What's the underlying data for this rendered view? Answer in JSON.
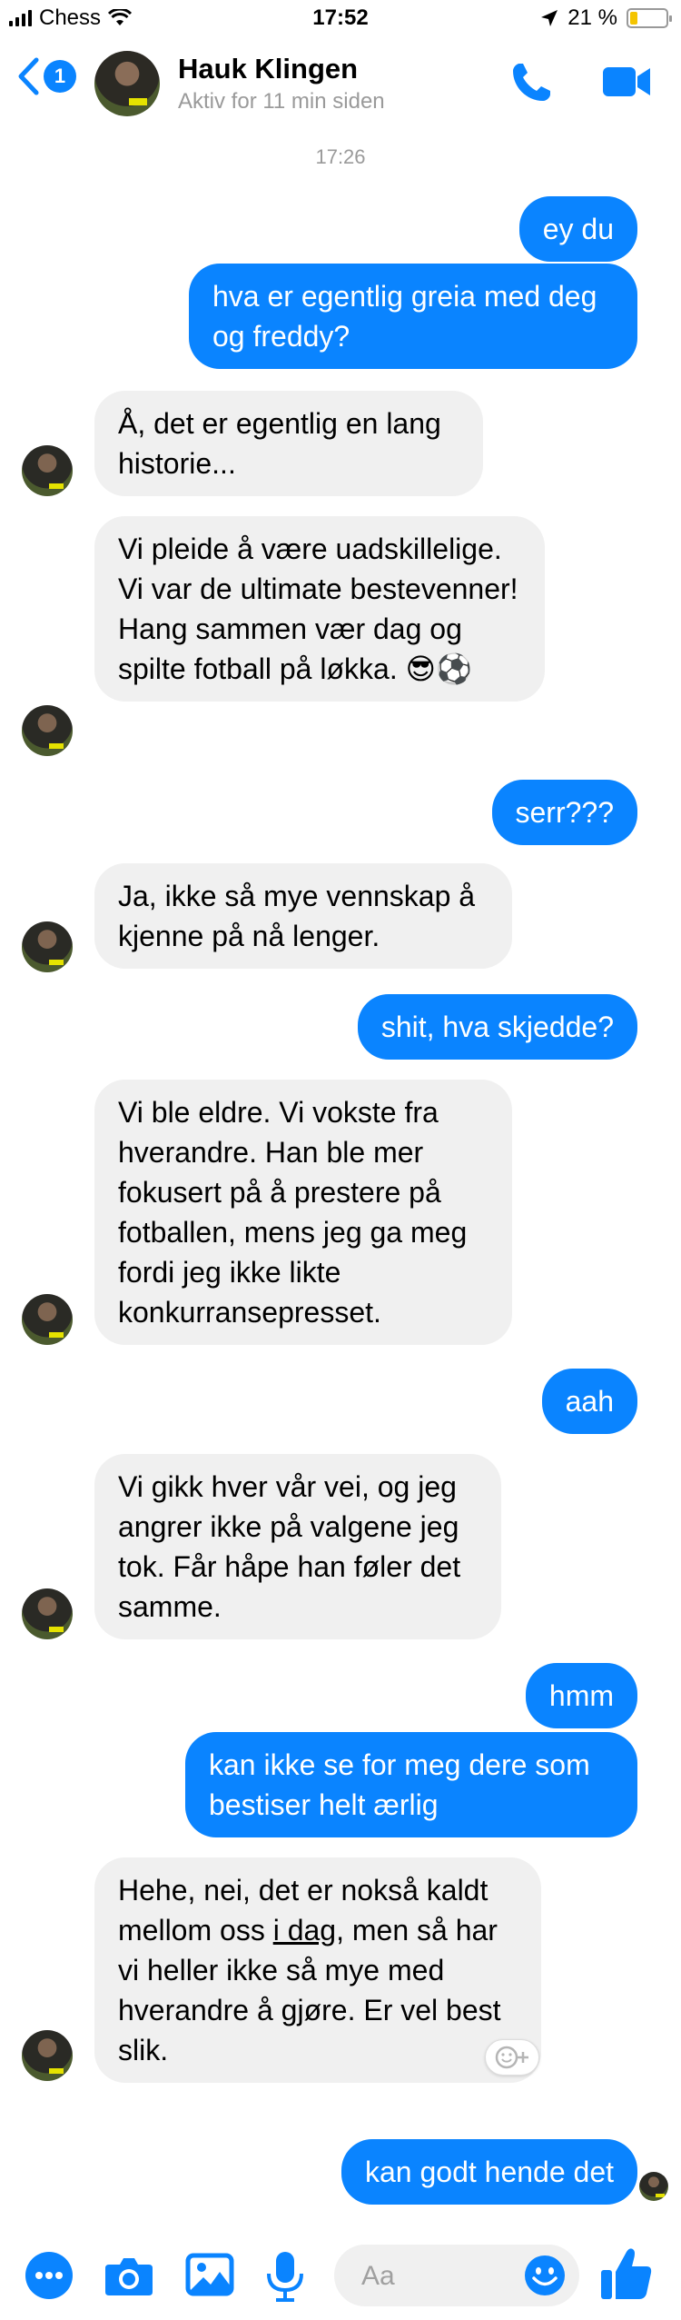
{
  "status_bar": {
    "carrier": "Chess",
    "time": "17:52",
    "battery": "21 %",
    "battery_level": 0.21
  },
  "header": {
    "back_count": "1",
    "name": "Hauk Klingen",
    "status": "Aktiv for 11 min siden"
  },
  "timestamp": "17:26",
  "messages": [
    {
      "dir": "out",
      "text": "ey du"
    },
    {
      "dir": "out",
      "text": "hva er egentlig greia med deg og freddy?"
    },
    {
      "dir": "in",
      "text": "Å, det er egentlig en lang historie..."
    },
    {
      "dir": "in",
      "text": "Vi pleide å være uadskillelige. Vi var de ultimate bestevenner! Hang sammen vær dag og spilte fotball på løkka. 😎⚽"
    },
    {
      "dir": "out",
      "text": "serr???"
    },
    {
      "dir": "in",
      "text": "Ja, ikke så mye vennskap å kjenne på nå lenger."
    },
    {
      "dir": "out",
      "text": "shit, hva skjedde?"
    },
    {
      "dir": "in",
      "text": "Vi ble eldre. Vi vokste fra hverandre. Han ble mer fokusert på å prestere på fotballen, mens jeg ga meg fordi jeg ikke likte konkurransepresset."
    },
    {
      "dir": "out",
      "text": "aah"
    },
    {
      "dir": "in",
      "text": "Vi gikk hver vår vei, og jeg angrer ikke på valgene jeg tok. Får håpe han føler det samme."
    },
    {
      "dir": "out",
      "text": "hmm"
    },
    {
      "dir": "out",
      "text": "kan ikke se for meg dere som bestiser helt ærlig"
    },
    {
      "dir": "in",
      "text_before": "Hehe, nei, det er nokså kaldt mellom oss ",
      "text_link": "i dag",
      "text_after": ", men så har vi heller ikke så mye med hverandre å gjøre. Er vel best slik."
    },
    {
      "dir": "out",
      "text": "kan godt hende det"
    }
  ],
  "composer": {
    "placeholder": "Aa"
  },
  "colors": {
    "accent": "#0a84ff",
    "incoming_bubble": "#f0f0f0",
    "battery": "#f4c400"
  },
  "icons": [
    "signal-icon",
    "wifi-icon",
    "location-icon",
    "battery-icon",
    "back-chevron-icon",
    "phone-icon",
    "video-call-icon",
    "react-smiley-icon",
    "more-icon",
    "camera-icon",
    "image-icon",
    "microphone-icon",
    "emoji-icon",
    "thumbs-up-icon"
  ]
}
